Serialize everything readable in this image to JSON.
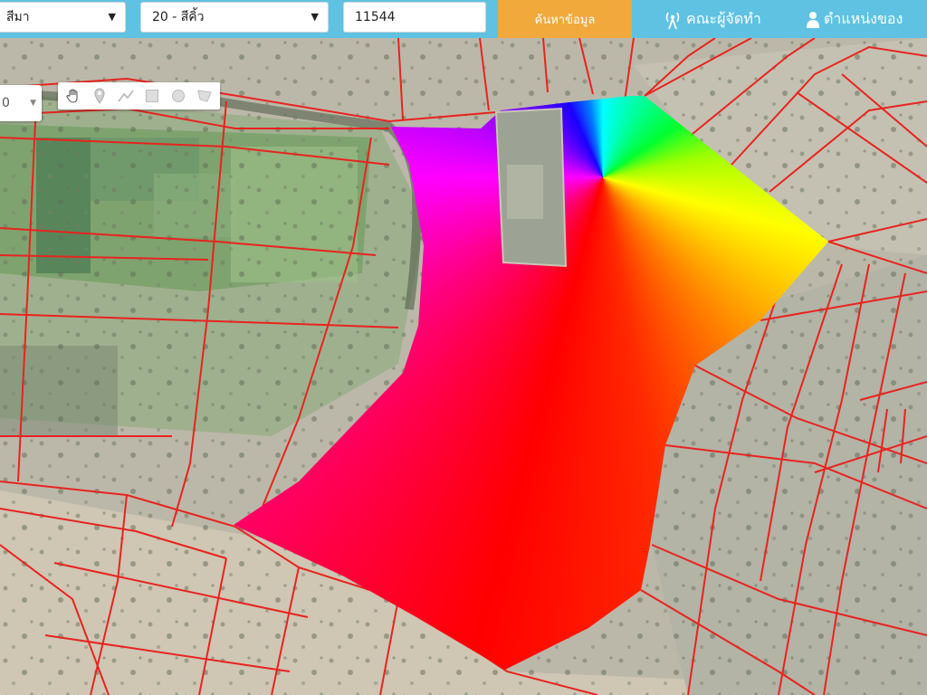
{
  "topbar": {
    "province": "สีมา",
    "district": "20 - สีคิ้ว",
    "parcel_number": "11544",
    "search_label": "ค้นหาข้อมูล",
    "team_label": "คณะผู้จัดทำ",
    "position_label": "ตำแหน่งของ"
  },
  "map": {
    "layer_value": "0",
    "tools": [
      {
        "icon": "hand-pan-icon"
      },
      {
        "icon": "marker-pin-icon"
      },
      {
        "icon": "polyline-icon"
      },
      {
        "icon": "rectangle-icon"
      },
      {
        "icon": "circle-icon"
      },
      {
        "icon": "polygon-icon"
      }
    ],
    "parcel_line_color": "#e8231f",
    "highlight_style": "rainbow conic gradient"
  },
  "colors": {
    "topbar_bg": "#5fc2e2",
    "search_button": "#f0a93a"
  }
}
